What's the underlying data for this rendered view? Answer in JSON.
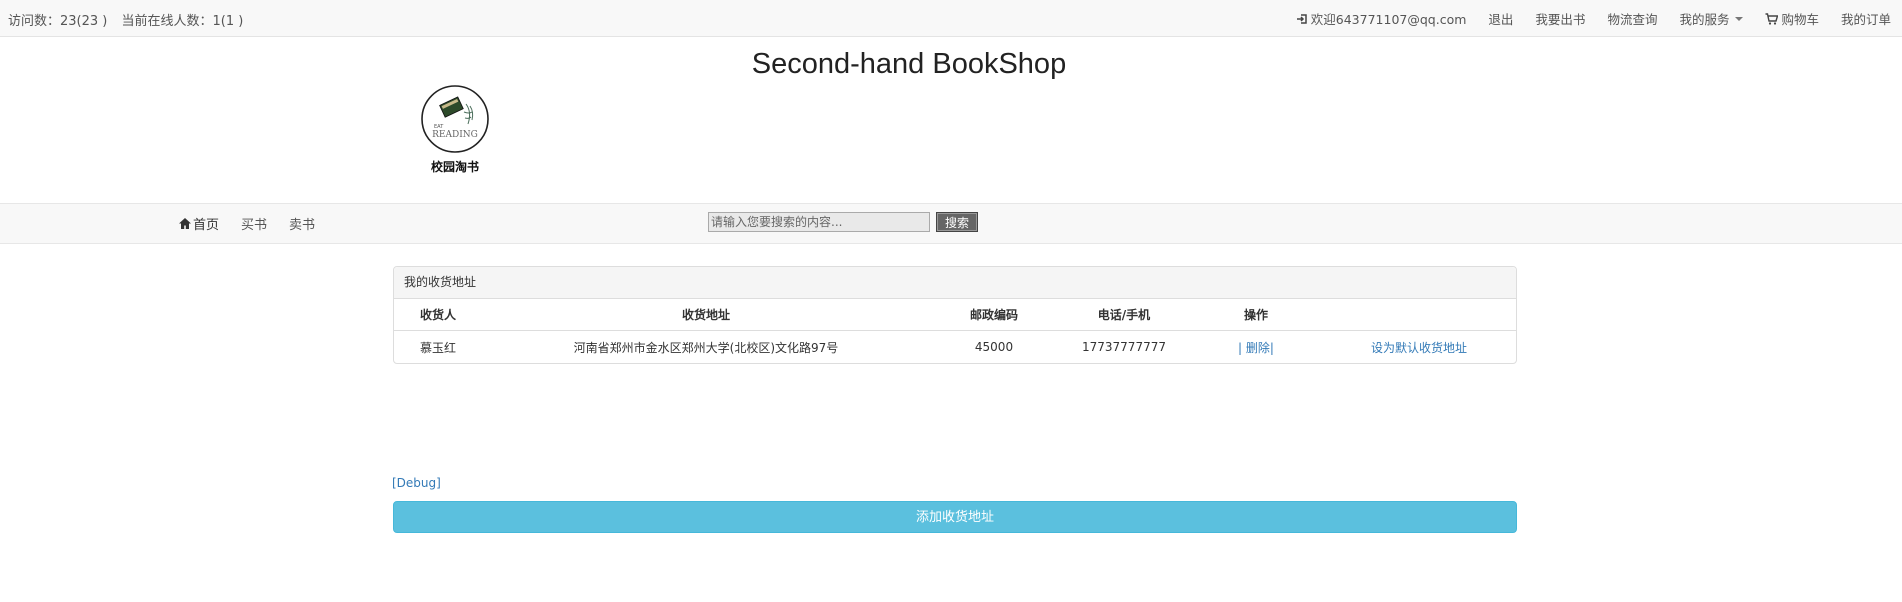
{
  "topbar": {
    "visits": "访问数：23(23 )",
    "online": "当前在线人数：1(1 )",
    "welcome": "欢迎643771107@qq.com",
    "logout": "退出",
    "sell": "我要出书",
    "logistics": "物流查询",
    "services": "我的服务",
    "cart": "购物车",
    "orders": "我的订单"
  },
  "header": {
    "title": "Second-hand BookShop",
    "logo_text": "校园淘书",
    "logo_word": "READING"
  },
  "nav": {
    "home": "首页",
    "buy": "买书",
    "sell": "卖书",
    "search_placeholder": "请输入您要搜索的内容...",
    "search_button": "搜索"
  },
  "panel": {
    "title": "我的收货地址",
    "headers": [
      "收货人",
      "收货地址",
      "邮政编码",
      "电话/手机",
      "操作"
    ],
    "rows": [
      {
        "name": "慕玉红",
        "address": "河南省郑州市金水区郑州大学(北校区)文化路97号",
        "postcode": "45000",
        "phone": "17737777777",
        "bar_left": "|",
        "delete": "删除",
        "bar_right": "|",
        "set_default": "设为默认收货地址"
      }
    ]
  },
  "debug": "[Debug]",
  "add_button": "添加收货地址",
  "colors": {
    "link": "#337ab7",
    "info_button": "#5bc0de",
    "bar_bg": "#f8f8f8"
  }
}
